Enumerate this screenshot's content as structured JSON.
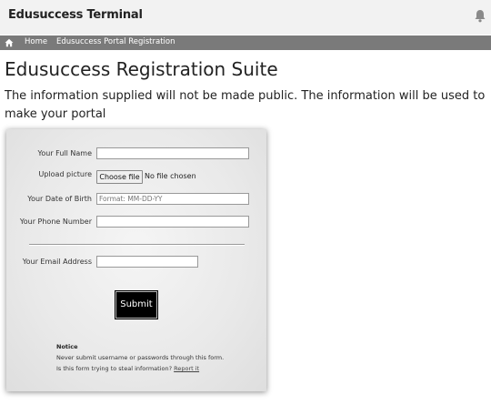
{
  "header": {
    "brand": "Edusuccess Terminal",
    "bell_icon": "bell-icon"
  },
  "breadcrumb": {
    "home_icon": "home-icon",
    "items": [
      "Home",
      "Edusuccess Portal Registration"
    ]
  },
  "page": {
    "title": "Edusuccess Registration Suite",
    "intro": "The information supplied will not be made public. The information will be used to make your portal"
  },
  "form": {
    "full_name": {
      "label": "Your Full Name",
      "value": "",
      "placeholder": ""
    },
    "picture": {
      "label": "Upload picture",
      "button": "Choose file",
      "status": "No file chosen"
    },
    "dob": {
      "label": "Your Date of Birth",
      "value": "",
      "placeholder": "Format: MM-DD-YY"
    },
    "phone": {
      "label": "Your Phone Number",
      "value": "",
      "placeholder": ""
    },
    "email": {
      "label": "Your Email Address",
      "value": "",
      "placeholder": ""
    },
    "submit_label": "Submit"
  },
  "notice": {
    "title": "Notice",
    "line1": "Never submit username or passwords through this form.",
    "line2_prefix": "Is this form trying to steal information? ",
    "report_link": "Report it"
  },
  "colors": {
    "topbar": "#f2f2f2",
    "breadcrumb_bar": "#7a7a7a",
    "submit_bg": "#000000"
  }
}
